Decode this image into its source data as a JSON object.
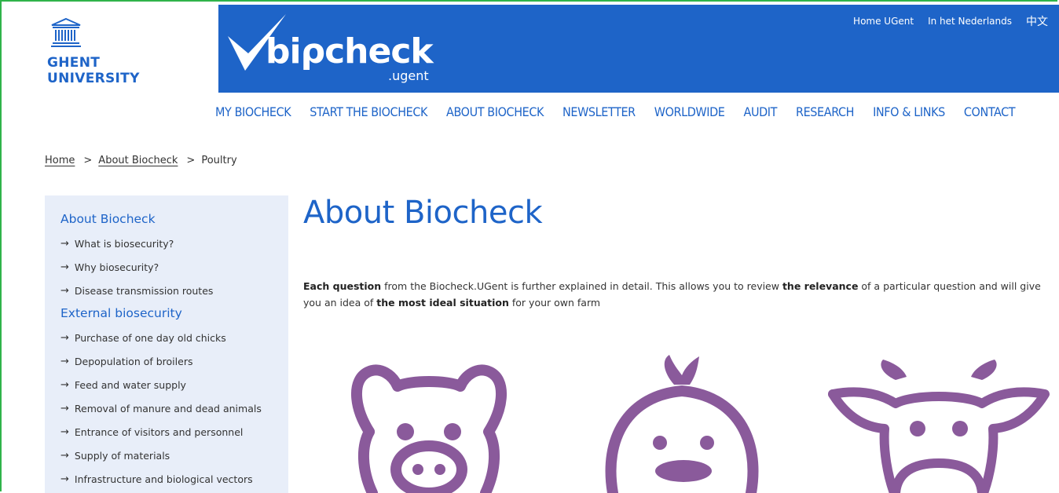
{
  "university": {
    "line1": "GHENT",
    "line2": "UNIVERSITY"
  },
  "brand": {
    "word": "biρcheck",
    "sub": ".ugent",
    "accent": "#1e64c8"
  },
  "top_links": [
    "Home UGent",
    "In het Nederlands",
    "中文"
  ],
  "nav": [
    "MY BIOCHECK",
    "START THE BIOCHECK",
    "ABOUT BIOCHECK",
    "NEWSLETTER",
    "WORLDWIDE",
    "AUDIT",
    "RESEARCH",
    "INFO & LINKS",
    "CONTACT"
  ],
  "breadcrumb": {
    "home": "Home",
    "section": "About Biocheck",
    "current": "Poultry",
    "separator": ">"
  },
  "sidebar": {
    "arrow": "→",
    "heading1": "About Biocheck",
    "group1": [
      "What is biosecurity?",
      "Why biosecurity?",
      "Disease transmission routes"
    ],
    "heading2": "External biosecurity",
    "group2": [
      "Purchase of one day old chicks",
      "Depopulation of broilers",
      "Feed and water supply",
      "Removal of manure and dead animals",
      "Entrance of visitors and personnel",
      "Supply of materials",
      "Infrastructure and biological vectors"
    ]
  },
  "main": {
    "title": "About Biocheck",
    "intro": {
      "p1": "Each question",
      "p2": " from the Biocheck.UGent is further explained in detail. This allows you to review ",
      "p3": "the relevance",
      "p4": " of a particular question and will give you an idea of ",
      "p5": "the most ideal situation",
      "p6": " for your own farm"
    }
  },
  "animals": {
    "icons": [
      "pig-icon",
      "chick-icon",
      "cow-icon"
    ],
    "color": "#8a5a9b"
  }
}
